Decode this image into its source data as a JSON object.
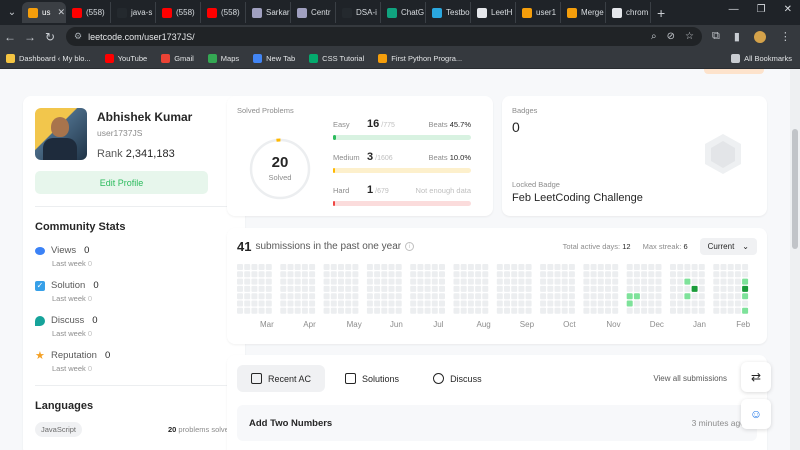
{
  "browser": {
    "tabs": [
      {
        "label": "us",
        "color": "#f59e0b",
        "active": true
      },
      {
        "label": "(558)",
        "color": "#ff0000",
        "active": false
      },
      {
        "label": "java-s",
        "color": "#24292e",
        "active": false
      },
      {
        "label": "(558)",
        "color": "#ff0000",
        "active": false
      },
      {
        "label": "(558)",
        "color": "#ff0000",
        "active": false
      },
      {
        "label": "Sarkar",
        "color": "#a0a0c0",
        "active": false
      },
      {
        "label": "Centr",
        "color": "#a0a0c0",
        "active": false
      },
      {
        "label": "DSA-i",
        "color": "#24292e",
        "active": false
      },
      {
        "label": "ChatG",
        "color": "#10a37f",
        "active": false
      },
      {
        "label": "Testbo",
        "color": "#2aa7df",
        "active": false
      },
      {
        "label": "LeetH",
        "color": "#e5e7eb",
        "active": false
      },
      {
        "label": "user1",
        "color": "#f59e0b",
        "active": false
      },
      {
        "label": "Merge",
        "color": "#f59e0b",
        "active": false
      },
      {
        "label": "chrom",
        "color": "#e5e7eb",
        "active": false
      }
    ],
    "url": "leetcode.com/user1737JS/",
    "bookmarks": [
      {
        "label": "Dashboard ‹ My blo...",
        "color": "#f5c542"
      },
      {
        "label": "YouTube",
        "color": "#ff0000"
      },
      {
        "label": "Gmail",
        "color": "#ea4335"
      },
      {
        "label": "Maps",
        "color": "#34a853"
      },
      {
        "label": "New Tab",
        "color": "#4285f4"
      },
      {
        "label": "CSS Tutorial",
        "color": "#04aa6d"
      },
      {
        "label": "First Python Progra...",
        "color": "#f59e0b"
      }
    ],
    "all_bookmarks": "All Bookmarks"
  },
  "profile": {
    "name": "Abhishek Kumar",
    "handle": "user1737JS",
    "rank_label": "Rank",
    "rank_value": "2,341,183",
    "edit_label": "Edit Profile"
  },
  "community": {
    "title": "Community Stats",
    "items": [
      {
        "label": "Views",
        "value": "0",
        "sub": "Last week",
        "sub_val": "0"
      },
      {
        "label": "Solution",
        "value": "0",
        "sub": "Last week",
        "sub_val": "0"
      },
      {
        "label": "Discuss",
        "value": "0",
        "sub": "Last week",
        "sub_val": "0"
      },
      {
        "label": "Reputation",
        "value": "0",
        "sub": "Last week",
        "sub_val": "0"
      }
    ]
  },
  "languages": {
    "title": "Languages",
    "lang": "JavaScript",
    "count": "20",
    "count_suffix": "problems solved"
  },
  "solved": {
    "title": "Solved Problems",
    "total": "20",
    "total_label": "Solved",
    "levels": [
      {
        "name": "Easy",
        "count": "16",
        "total": "/775",
        "beats_label": "Beats",
        "beats": "45.7%",
        "color": "#2cbb5d",
        "track": "#d8f2e1",
        "fraction": 0.021
      },
      {
        "name": "Medium",
        "count": "3",
        "total": "/1606",
        "beats_label": "Beats",
        "beats": "10.0%",
        "color": "#ffb800",
        "track": "#fdf0cc",
        "fraction": 0.002
      },
      {
        "name": "Hard",
        "count": "1",
        "total": "/679",
        "beats_label": "",
        "beats": "Not enough data",
        "color": "#ef4743",
        "track": "#fbdcdc",
        "fraction": 0.0015
      }
    ]
  },
  "badges": {
    "label": "Badges",
    "count": "0",
    "locked_label": "Locked Badge",
    "locked_name": "Feb LeetCoding Challenge"
  },
  "submissions": {
    "count": "41",
    "text": "submissions in the past one year",
    "active_label": "Total active days:",
    "active_days": "12",
    "streak_label": "Max streak:",
    "streak": "6",
    "dropdown": "Current",
    "months": [
      "Mar",
      "Apr",
      "May",
      "Jun",
      "Jul",
      "Aug",
      "Sep",
      "Oct",
      "Nov",
      "Dec",
      "Jan",
      "Feb"
    ]
  },
  "recent": {
    "tabs": [
      {
        "label": "Recent AC",
        "active": true
      },
      {
        "label": "Solutions",
        "active": false
      },
      {
        "label": "Discuss",
        "active": false
      }
    ],
    "view_all": "View all submissions",
    "items": [
      {
        "title": "Add Two Numbers",
        "time": "3 minutes ago"
      }
    ]
  }
}
